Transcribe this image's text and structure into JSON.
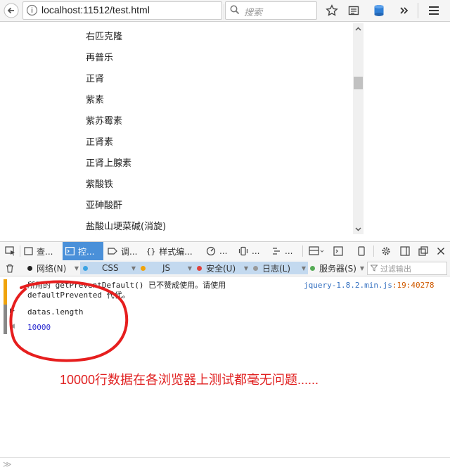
{
  "browser": {
    "url": "localhost:11512/test.html",
    "search_placeholder": "搜索"
  },
  "list": {
    "items": [
      "右匹克隆",
      "再普乐",
      "正肾",
      "紫素",
      "紫苏霉素",
      "正肾素",
      "正肾上腺素",
      "紫酸铁",
      "亚砷酸酐",
      "盐酸山埂菜碱(消旋)"
    ]
  },
  "devtools": {
    "tabs": [
      {
        "label": "查..."
      },
      {
        "label": "控..."
      },
      {
        "label": "调..."
      },
      {
        "label": "样式编..."
      },
      {
        "label": "..."
      },
      {
        "label": "..."
      },
      {
        "label": "..."
      }
    ],
    "filters": {
      "network": "网络(N)",
      "css": "CSS",
      "js": "JS",
      "security": "安全(U)",
      "logging": "日志(L)",
      "server": "服务器(S)",
      "filter_placeholder": "过滤输出"
    },
    "colors": {
      "network": "#222222",
      "css": "#3aa3e3",
      "js": "#f0a30a",
      "security": "#e0403a",
      "logging": "#999999",
      "server": "#55aa55"
    }
  },
  "console": {
    "warning_line1": "所用的 getPreventDefault() 已不赞成使用。请使用",
    "warning_line2": "defaultPrevented 代代。",
    "warning_source_file": "jquery-1.8.2.min.js",
    "warning_source_loc": ":19:40278",
    "command": "datas.length",
    "result": "10000",
    "annotation": "10000行数据在各浏览器上测试都毫无问题......",
    "prompt": "≫"
  }
}
